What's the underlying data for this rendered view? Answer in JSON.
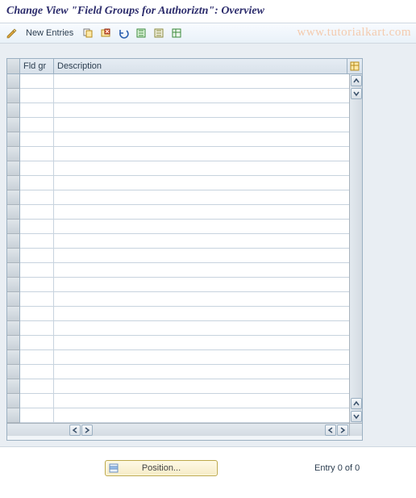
{
  "title": "Change View \"Field Groups for Authoriztn\": Overview",
  "watermark": "www.tutorialkart.com",
  "toolbar": {
    "new_entries_label": "New Entries"
  },
  "table": {
    "columns": {
      "fld_gr": "Fld gr",
      "description": "Description"
    },
    "rows": [
      {
        "fld_gr": "",
        "description": ""
      },
      {
        "fld_gr": "",
        "description": ""
      },
      {
        "fld_gr": "",
        "description": ""
      },
      {
        "fld_gr": "",
        "description": ""
      },
      {
        "fld_gr": "",
        "description": ""
      },
      {
        "fld_gr": "",
        "description": ""
      },
      {
        "fld_gr": "",
        "description": ""
      },
      {
        "fld_gr": "",
        "description": ""
      },
      {
        "fld_gr": "",
        "description": ""
      },
      {
        "fld_gr": "",
        "description": ""
      },
      {
        "fld_gr": "",
        "description": ""
      },
      {
        "fld_gr": "",
        "description": ""
      },
      {
        "fld_gr": "",
        "description": ""
      },
      {
        "fld_gr": "",
        "description": ""
      },
      {
        "fld_gr": "",
        "description": ""
      },
      {
        "fld_gr": "",
        "description": ""
      },
      {
        "fld_gr": "",
        "description": ""
      },
      {
        "fld_gr": "",
        "description": ""
      },
      {
        "fld_gr": "",
        "description": ""
      },
      {
        "fld_gr": "",
        "description": ""
      },
      {
        "fld_gr": "",
        "description": ""
      },
      {
        "fld_gr": "",
        "description": ""
      },
      {
        "fld_gr": "",
        "description": ""
      },
      {
        "fld_gr": "",
        "description": ""
      }
    ]
  },
  "footer": {
    "position_label": "Position...",
    "entry_text": "Entry 0 of 0"
  }
}
